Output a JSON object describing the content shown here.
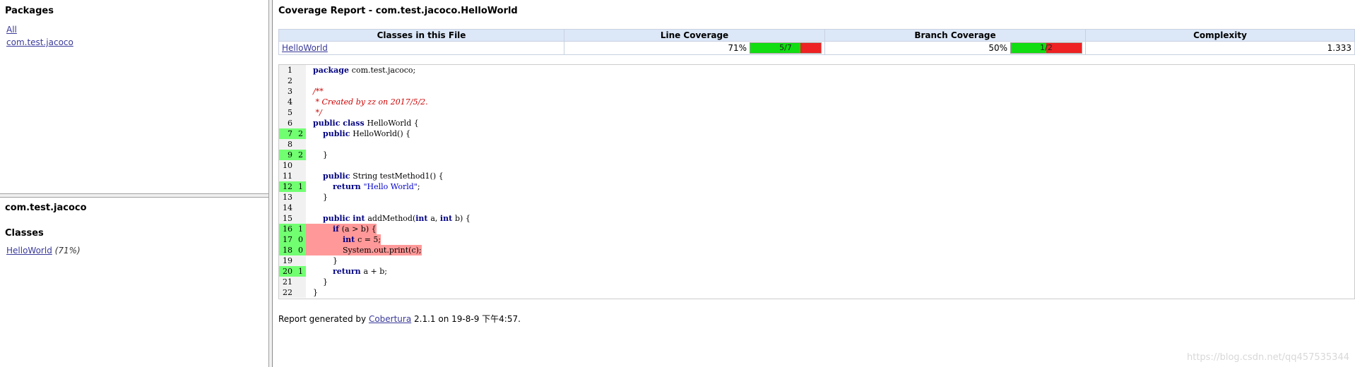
{
  "packages_frame": {
    "heading": "Packages",
    "items": [
      "All",
      "com.test.jacoco"
    ]
  },
  "package_frame": {
    "package_name": "com.test.jacoco",
    "classes_heading": "Classes",
    "classes": [
      {
        "name": "HelloWorld",
        "coverage": "(71%)"
      }
    ]
  },
  "report": {
    "title": "Coverage Report - com.test.jacoco.HelloWorld",
    "table": {
      "headers": [
        "Classes in this File",
        "Line Coverage",
        "Branch Coverage",
        "Complexity"
      ],
      "row": {
        "class_name": "HelloWorld",
        "line_pct": "71%",
        "line_ratio": "5/7",
        "line_fraction": 0.714,
        "branch_pct": "50%",
        "branch_ratio": "1/2",
        "branch_fraction": 0.5,
        "complexity": "1.333"
      }
    },
    "source": [
      {
        "n": "1",
        "hits": "",
        "cov": false,
        "red": false,
        "tokens": [
          [
            "kw",
            "package"
          ],
          [
            "",
            "com.test.jacoco;"
          ]
        ]
      },
      {
        "n": "2",
        "hits": "",
        "cov": false,
        "red": false,
        "tokens": []
      },
      {
        "n": "3",
        "hits": "",
        "cov": false,
        "red": false,
        "tokens": [
          [
            "cm",
            "/**"
          ]
        ]
      },
      {
        "n": "4",
        "hits": "",
        "cov": false,
        "red": false,
        "tokens": [
          [
            "cm",
            " * Created by zz on 2017/5/2."
          ]
        ]
      },
      {
        "n": "5",
        "hits": "",
        "cov": false,
        "red": false,
        "tokens": [
          [
            "cm",
            " */"
          ]
        ]
      },
      {
        "n": "6",
        "hits": "",
        "cov": false,
        "red": false,
        "tokens": [
          [
            "kw",
            "public class"
          ],
          [
            "",
            "HelloWorld {"
          ]
        ]
      },
      {
        "n": "7",
        "hits": "2",
        "cov": true,
        "red": false,
        "tokens": [
          [
            "",
            "    "
          ],
          [
            "kw",
            "public"
          ],
          [
            "",
            "HelloWorld() {"
          ]
        ]
      },
      {
        "n": "8",
        "hits": "",
        "cov": false,
        "red": false,
        "tokens": []
      },
      {
        "n": "9",
        "hits": "2",
        "cov": true,
        "red": false,
        "tokens": [
          [
            "",
            "    }"
          ]
        ]
      },
      {
        "n": "10",
        "hits": "",
        "cov": false,
        "red": false,
        "tokens": []
      },
      {
        "n": "11",
        "hits": "",
        "cov": false,
        "red": false,
        "tokens": [
          [
            "",
            "    "
          ],
          [
            "kw",
            "public"
          ],
          [
            "",
            "String testMethod1() {"
          ]
        ]
      },
      {
        "n": "12",
        "hits": "1",
        "cov": true,
        "red": false,
        "tokens": [
          [
            "",
            "        "
          ],
          [
            "kw",
            "return"
          ],
          [
            "str",
            "\"Hello World\""
          ],
          [
            "",
            ";"
          ]
        ]
      },
      {
        "n": "13",
        "hits": "",
        "cov": false,
        "red": false,
        "tokens": [
          [
            "",
            "    }"
          ]
        ]
      },
      {
        "n": "14",
        "hits": "",
        "cov": false,
        "red": false,
        "tokens": []
      },
      {
        "n": "15",
        "hits": "",
        "cov": false,
        "red": false,
        "tokens": [
          [
            "",
            "    "
          ],
          [
            "kw",
            "public int"
          ],
          [
            "",
            "addMethod("
          ],
          [
            "kw",
            "int"
          ],
          [
            "",
            "a, "
          ],
          [
            "kw",
            "int"
          ],
          [
            "",
            "b) {"
          ]
        ]
      },
      {
        "n": "16",
        "hits": "1",
        "cov": true,
        "red": true,
        "tokens": [
          [
            "",
            "        "
          ],
          [
            "kw",
            "if"
          ],
          [
            "",
            "(a > b) {"
          ]
        ]
      },
      {
        "n": "17",
        "hits": "0",
        "cov": true,
        "red": true,
        "tokens": [
          [
            "",
            "            "
          ],
          [
            "kw",
            "int"
          ],
          [
            "",
            "c = 5;"
          ]
        ]
      },
      {
        "n": "18",
        "hits": "0",
        "cov": true,
        "red": true,
        "tokens": [
          [
            "",
            "            System.out.print(c);"
          ]
        ]
      },
      {
        "n": "19",
        "hits": "",
        "cov": false,
        "red": false,
        "tokens": [
          [
            "",
            "        }"
          ]
        ]
      },
      {
        "n": "20",
        "hits": "1",
        "cov": true,
        "red": false,
        "tokens": [
          [
            "",
            "        "
          ],
          [
            "kw",
            "return"
          ],
          [
            "",
            "a + b;"
          ]
        ]
      },
      {
        "n": "21",
        "hits": "",
        "cov": false,
        "red": false,
        "tokens": [
          [
            "",
            "    }"
          ]
        ]
      },
      {
        "n": "22",
        "hits": "",
        "cov": false,
        "red": false,
        "tokens": [
          [
            "",
            "}"
          ]
        ]
      }
    ],
    "footer": {
      "prefix": "Report generated by",
      "link": "Cobertura",
      "suffix": "2.1.1 on 19-8-9 下午4:57."
    }
  },
  "watermark": "https://blog.csdn.net/qq457535344"
}
